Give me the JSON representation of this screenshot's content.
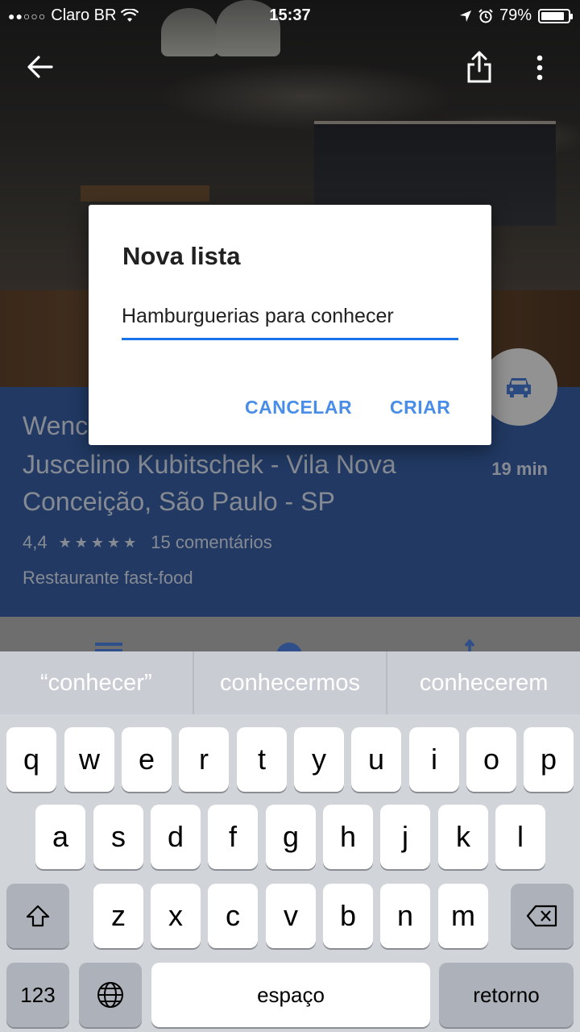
{
  "status_bar": {
    "carrier": "Claro BR",
    "time": "15:37",
    "battery": "79%",
    "battery_level": 0.79
  },
  "place": {
    "name_line1": "Wenc",
    "name_line2": "Juscelino Kubitschek - Vila Nova",
    "name_line3": "Conceição, São Paulo - SP",
    "rating": "4,4",
    "stars": "★★★★★",
    "reviews": "15 comentários",
    "category": "Restaurante fast-food",
    "eta": "19 min"
  },
  "dialog": {
    "title": "Nova lista",
    "input_value": "Hamburguerias para conhecer",
    "cancel_label": "CANCELAR",
    "create_label": "CRIAR"
  },
  "keyboard": {
    "suggestions": [
      "“conhecer”",
      "conhecermos",
      "conhecerem"
    ],
    "row1": [
      "q",
      "w",
      "e",
      "r",
      "t",
      "y",
      "u",
      "i",
      "o",
      "p"
    ],
    "row2": [
      "a",
      "s",
      "d",
      "f",
      "g",
      "h",
      "j",
      "k",
      "l"
    ],
    "row3": [
      "z",
      "x",
      "c",
      "v",
      "b",
      "n",
      "m"
    ],
    "numbers_label": "123",
    "space_label": "espaço",
    "return_label": "retorno"
  },
  "colors": {
    "accent": "#1a73e8",
    "panel": "#2f4f8a"
  }
}
